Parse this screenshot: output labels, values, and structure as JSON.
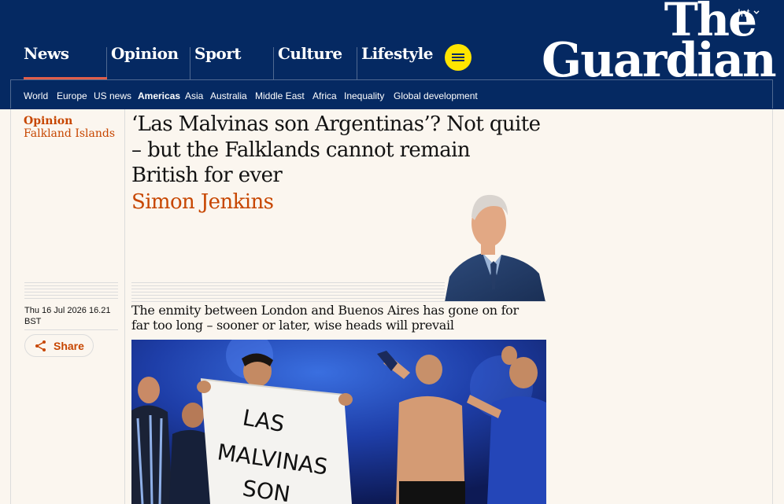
{
  "header": {
    "edition": "Int",
    "logo_line1": "The",
    "logo_line2": "Guardian",
    "pillars": [
      "News",
      "Opinion",
      "Sport",
      "Culture",
      "Lifestyle"
    ],
    "active_pillar": "News"
  },
  "subnav": [
    "World",
    "Europe",
    "US news",
    "Americas",
    "Asia",
    "Australia",
    "Middle East",
    "Africa",
    "Inequality",
    "Global development"
  ],
  "subnav_active": "Americas",
  "article": {
    "section": "Opinion",
    "series": "Falkland Islands",
    "headline": "‘Las Malvinas son Argentinas’? Not quite – but the Falklands cannot remain British for ever",
    "byline": "Simon Jenkins",
    "date_line1": "Thu 16 Jul 2026 16.21",
    "date_line2": "BST",
    "share_label": "Share",
    "standfirst": "The enmity between London and Buenos Aires has gone on for far too long – sooner or later, wise heads will prevail",
    "banner_text": [
      "LAS",
      "MALVINAS",
      "SON"
    ]
  },
  "colors": {
    "brand_blue": "#052962",
    "opinion_orange": "#c74600",
    "menu_yellow": "#ffe500",
    "news_red": "#e05e4a",
    "background": "#fbf6ef"
  },
  "icons": [
    "chevron-down-icon",
    "menu-icon",
    "share-icon"
  ]
}
